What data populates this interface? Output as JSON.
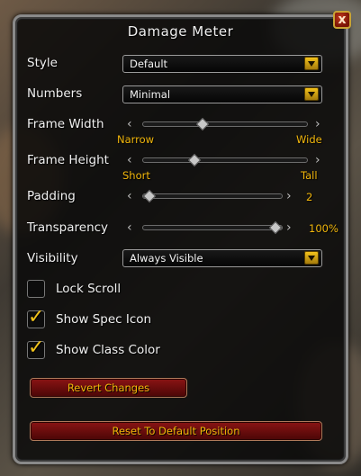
{
  "window": {
    "title": "Damage Meter",
    "close_label": "x"
  },
  "settings": {
    "style": {
      "label": "Style",
      "value": "Default"
    },
    "numbers": {
      "label": "Numbers",
      "value": "Minimal"
    },
    "frame_width": {
      "label": "Frame Width",
      "min_label": "Narrow",
      "max_label": "Wide",
      "level": 0.35
    },
    "frame_height": {
      "label": "Frame Height",
      "min_label": "Short",
      "max_label": "Tall",
      "level": 0.3
    },
    "padding": {
      "label": "Padding",
      "value": "2",
      "level": 0.0
    },
    "transparency": {
      "label": "Transparency",
      "value": "100%",
      "level": 1.0
    },
    "visibility": {
      "label": "Visibility",
      "value": "Always Visible"
    }
  },
  "checkboxes": [
    {
      "label": "Lock Scroll",
      "checked": false
    },
    {
      "label": "Show Spec Icon",
      "checked": true
    },
    {
      "label": "Show Class Color",
      "checked": true
    }
  ],
  "buttons": {
    "revert": "Revert Changes",
    "reset": "Reset To Default Position"
  },
  "colors": {
    "accent_gold": "#f1b60b",
    "button_red": "#8a1414"
  }
}
